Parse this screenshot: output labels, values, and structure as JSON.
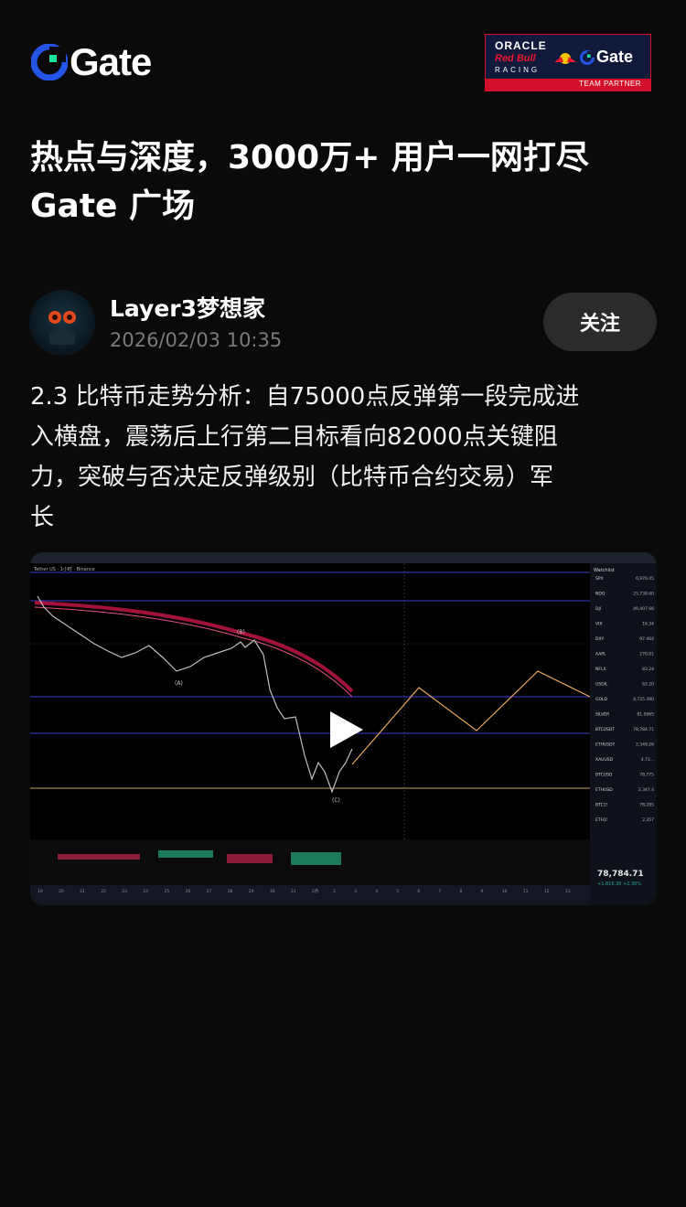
{
  "brand": {
    "name": "Gate"
  },
  "partner_badge": {
    "line1": "ORACLE",
    "line2": "Red Bull",
    "line3": "RACING",
    "brand": "Gate",
    "label": "TEAM PARTNER"
  },
  "headline": {
    "line1": "热点与深度，3000万+ 用户一网打尽",
    "line2": "Gate 广场"
  },
  "post": {
    "author": "Layer3梦想家",
    "timestamp": "2026/02/03 10:35",
    "follow_label": "关注",
    "body_lines": [
      "2.3 比特币走势分析：自75000点反弹第一段完成进",
      "入横盘，震荡后上行第二目标看向82000点关键阻",
      "力，突破与否决定反弹级别（比特币合约交易）军",
      "长"
    ]
  },
  "chart_screenshot": {
    "symbol": "Tether US · 1小时 · Binance",
    "wave_labels": [
      "(A)",
      "(B)",
      "(C)"
    ],
    "watchlist_title": "Watchlist",
    "watchlist": [
      {
        "sym": "SPX",
        "val": "6,976.45"
      },
      {
        "sym": "NDQ",
        "val": "25,738.60"
      },
      {
        "sym": "DJI",
        "val": "49,407.66"
      },
      {
        "sym": "VIX",
        "val": "16.34"
      },
      {
        "sym": "DXY",
        "val": "97.464"
      },
      {
        "sym": "AAPL",
        "val": "270.01"
      },
      {
        "sym": "NFLX",
        "val": "83.24"
      },
      {
        "sym": "USOIL",
        "val": "62.20"
      },
      {
        "sym": "GOLD",
        "val": "4,725.390"
      },
      {
        "sym": "SILVER",
        "val": "81.0965"
      },
      {
        "sym": "BTCUSDT",
        "val": "78,784.71"
      },
      {
        "sym": "ETHUSDT",
        "val": "2,349.26"
      },
      {
        "sym": "XAUUSD",
        "val": "4,73..."
      },
      {
        "sym": "BTCUSD",
        "val": "78,775"
      },
      {
        "sym": "ETHUSD",
        "val": "2,347.4"
      },
      {
        "sym": "BTC1!",
        "val": "78,285"
      },
      {
        "sym": "ETH1!",
        "val": "2,357"
      }
    ],
    "price_big": "78,784.71",
    "price_change": "+1,816.30 +2.36%",
    "time_ticks": [
      "19",
      "20",
      "21",
      "22",
      "23",
      "24",
      "25",
      "26",
      "27",
      "28",
      "29",
      "30",
      "31",
      "2月",
      "2",
      "3",
      "4",
      "5",
      "6",
      "7",
      "8",
      "9",
      "10",
      "11",
      "12",
      "13"
    ]
  }
}
